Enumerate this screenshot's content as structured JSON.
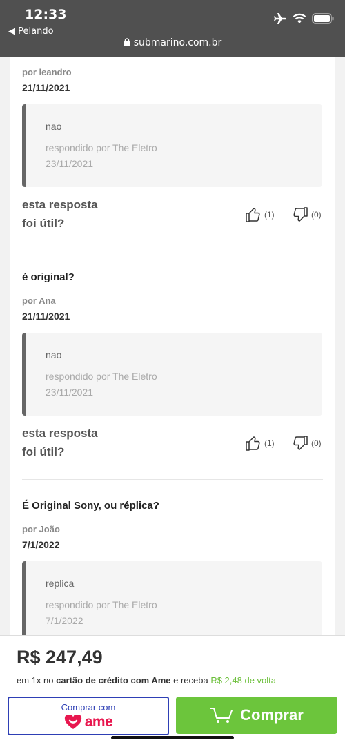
{
  "status": {
    "time": "12:33",
    "back_label": "◀ Pelando",
    "url": "submarino.com.br"
  },
  "questions": [
    {
      "question": "",
      "author": "por leandro",
      "date": "21/11/2021",
      "answer": "nao",
      "answered_by": "respondido por The Eletro",
      "answer_date": "23/11/2021",
      "helpful_line1": "esta resposta",
      "helpful_line2": "foi útil?",
      "likes": "(1)",
      "dislikes": "(0)"
    },
    {
      "question": "é original?",
      "author": "por Ana",
      "date": "21/11/2021",
      "answer": "nao",
      "answered_by": "respondido por The Eletro",
      "answer_date": "23/11/2021",
      "helpful_line1": "esta resposta",
      "helpful_line2": "foi útil?",
      "likes": "(1)",
      "dislikes": "(0)"
    },
    {
      "question": "É Original Sony, ou réplica?",
      "author": "por João",
      "date": "7/1/2022",
      "answer": "replica",
      "answered_by": "respondido por The Eletro",
      "answer_date": "7/1/2022"
    }
  ],
  "purchase": {
    "price": "R$ 247,49",
    "installment_prefix": "em 1x no ",
    "installment_card": "cartão de crédito com Ame",
    "installment_middle": " e receba ",
    "cashback": "R$ 2,48 de volta",
    "ame_button_label": "Comprar com",
    "ame_logo_text": "ame",
    "buy_button_label": "Comprar"
  },
  "colors": {
    "accent_green": "#6cc53c",
    "ame_blue": "#2e3fb5",
    "ame_pink": "#e8174f"
  }
}
